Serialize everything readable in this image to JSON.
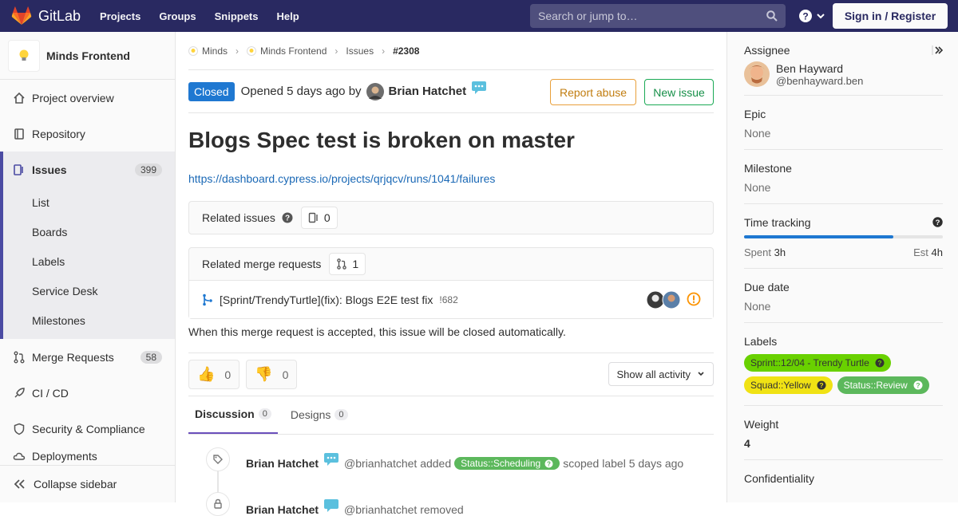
{
  "topbar": {
    "brand": "GitLab",
    "nav": [
      "Projects",
      "Groups",
      "Snippets",
      "Help"
    ],
    "search_placeholder": "Search or jump to…",
    "signin": "Sign in / Register"
  },
  "sidebar": {
    "project_name": "Minds Frontend",
    "items": [
      {
        "label": "Project overview",
        "icon": "home-icon"
      },
      {
        "label": "Repository",
        "icon": "book-icon"
      }
    ],
    "issues": {
      "label": "Issues",
      "count": "399",
      "sub": [
        "List",
        "Boards",
        "Labels",
        "Service Desk",
        "Milestones"
      ]
    },
    "items2": [
      {
        "label": "Merge Requests",
        "count": "58",
        "icon": "merge-request-icon"
      },
      {
        "label": "CI / CD",
        "icon": "rocket-icon"
      },
      {
        "label": "Security & Compliance",
        "icon": "shield-icon"
      },
      {
        "label": "Deployments",
        "icon": "cloud-icon"
      }
    ],
    "collapse": "Collapse sidebar"
  },
  "breadcrumb": [
    "Minds",
    "Minds Frontend",
    "Issues",
    "#2308"
  ],
  "issue": {
    "status": "Closed",
    "opened_text": "Opened 5 days ago by",
    "author": "Brian Hatchet",
    "report_abuse": "Report abuse",
    "new_issue": "New issue",
    "title": "Blogs Spec test is broken on master",
    "link": "https://dashboard.cypress.io/projects/qrjqcv/runs/1041/failures"
  },
  "related_issues": {
    "label": "Related issues",
    "count": "0"
  },
  "related_mrs": {
    "label": "Related merge requests",
    "count": "1",
    "mr_title": "[Sprint/TrendyTurtle](fix): Blogs E2E test fix",
    "mr_ref": "!682",
    "note": "When this merge request is accepted, this issue will be closed automatically."
  },
  "awards": {
    "thumbs_up": "0",
    "thumbs_down": "0",
    "activity": "Show all activity"
  },
  "tabs": [
    {
      "label": "Discussion",
      "count": "0"
    },
    {
      "label": "Designs",
      "count": "0"
    }
  ],
  "timeline": [
    {
      "name": "Brian Hatchet",
      "handle": "@brianhatchet added",
      "label": "Status::Scheduling",
      "suffix": "scoped label 5 days ago"
    },
    {
      "name": "Brian Hatchet",
      "handle": "@brianhatchet removed",
      "label": "",
      "suffix": ""
    }
  ],
  "right": {
    "assignee_title": "Assignee",
    "assignee_name": "Ben Hayward",
    "assignee_handle": "@benhayward.ben",
    "epic_title": "Epic",
    "epic_value": "None",
    "milestone_title": "Milestone",
    "milestone_value": "None",
    "time_title": "Time tracking",
    "spent_label": "Spent",
    "spent_value": "3h",
    "est_label": "Est",
    "est_value": "4h",
    "progress": 0.75,
    "due_title": "Due date",
    "due_value": "None",
    "labels_title": "Labels",
    "labels": [
      {
        "text": "Sprint::12/04 - Trendy Turtle",
        "bg": "#69d100",
        "fg": "#333333"
      },
      {
        "text": "Squad::Yellow",
        "bg": "#f0e214",
        "fg": "#333333"
      },
      {
        "text": "Status::Review",
        "bg": "#5cb85c",
        "fg": "#ffffff"
      }
    ],
    "weight_title": "Weight",
    "weight_value": "4",
    "confidentiality_title": "Confidentiality"
  }
}
